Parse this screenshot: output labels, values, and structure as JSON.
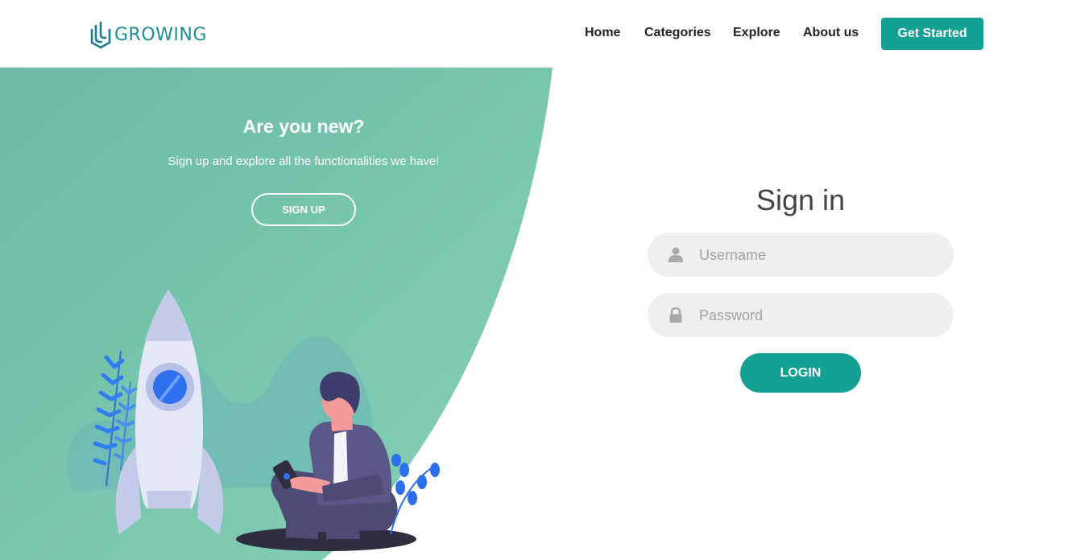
{
  "header": {
    "brand": "GROWING",
    "nav": [
      {
        "label": "Home"
      },
      {
        "label": "Categories"
      },
      {
        "label": "Explore"
      },
      {
        "label": "About us"
      }
    ],
    "cta_label": "Get Started"
  },
  "promo": {
    "title": "Are you new?",
    "subtitle": "Sign up and explore all the functionalities we have!",
    "signup_label": "SIGN UP",
    "illustration_icons": [
      "rocket-icon",
      "person-with-phone-icon",
      "plant-icon"
    ]
  },
  "signin": {
    "title": "Sign in",
    "username_placeholder": "Username",
    "password_placeholder": "Password",
    "login_label": "LOGIN",
    "icons": [
      "user-icon",
      "lock-icon"
    ]
  },
  "colors": {
    "accent": "#14a092",
    "brand": "#1d8f95",
    "panel_start": "#6cbaa6",
    "panel_end": "#86d1b6",
    "field_bg": "#efefef"
  }
}
